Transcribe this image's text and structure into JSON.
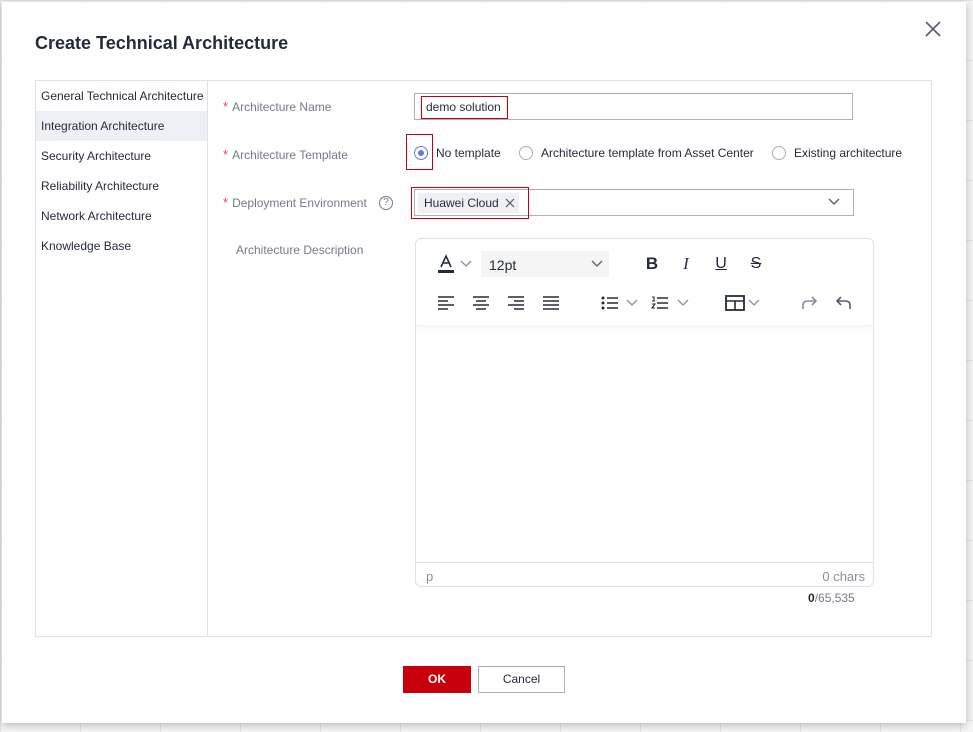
{
  "dialog": {
    "title": "Create Technical Architecture",
    "close_icon": "close-icon"
  },
  "sidebar": {
    "items": [
      {
        "label": "General Technical Architecture",
        "active": false
      },
      {
        "label": "Integration Architecture",
        "active": true
      },
      {
        "label": "Security Architecture",
        "active": false
      },
      {
        "label": "Reliability Architecture",
        "active": false
      },
      {
        "label": "Network Architecture",
        "active": false
      },
      {
        "label": "Knowledge Base",
        "active": false
      }
    ]
  },
  "form": {
    "required_mark": "*",
    "name": {
      "label": "Architecture Name",
      "value": "demo solution"
    },
    "template": {
      "label": "Architecture Template",
      "options": [
        "No template",
        "Architecture template from Asset Center",
        "Existing architecture"
      ],
      "selected": "No template"
    },
    "environment": {
      "label": "Deployment Environment",
      "help_icon": "?",
      "tags": [
        "Huawei Cloud"
      ]
    },
    "description": {
      "label": "Architecture Description",
      "font_size": "12pt",
      "status_element": "p",
      "char_status": "0 chars",
      "counter_current": "0",
      "counter_max": "/65,535"
    }
  },
  "footer": {
    "ok_label": "OK",
    "cancel_label": "Cancel"
  },
  "colors": {
    "primary": "#c7000b",
    "radio_selected": "#5e7ce0",
    "required": "#e54545",
    "sidebar_active_bg": "#eef0f5"
  }
}
